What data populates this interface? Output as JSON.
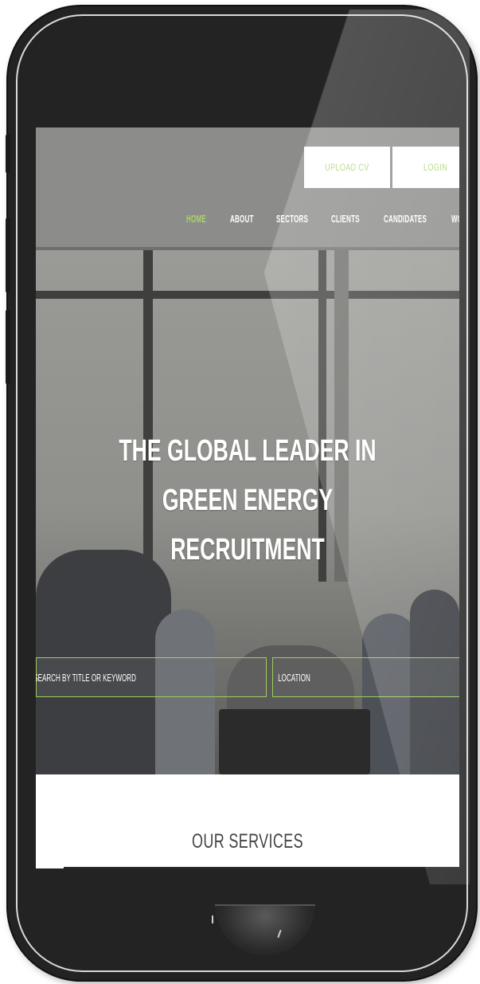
{
  "header": {
    "upload_cv": "UPLOAD CV",
    "login": "LOGIN"
  },
  "nav": {
    "items": [
      "HOME",
      "ABOUT",
      "SECTORS",
      "CLIENTS",
      "CANDIDATES",
      "WO"
    ]
  },
  "hero": {
    "title_line1": "THE GLOBAL LEADER IN",
    "title_line2": "GREEN ENERGY RECRUITMENT",
    "search_placeholder": "SEARCH BY TITLE OR KEYWORD",
    "location_placeholder": "LOCATION",
    "slides": 3,
    "active_slide": 0
  },
  "services": {
    "title": "OUR SERVICES"
  },
  "colors": {
    "accent": "#a9d46a",
    "header_bg": "#8c8c8a",
    "phone_frame": "#232323"
  }
}
